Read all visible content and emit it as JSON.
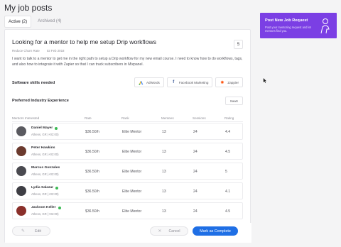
{
  "page": {
    "title": "My job posts"
  },
  "tabs": [
    {
      "label": "Active (2)",
      "active": true
    },
    {
      "label": "Archived (4)",
      "active": false
    }
  ],
  "job": {
    "title": "Looking for a mentor to help me setup Drip workflows",
    "category": "Reduce Churn Rate",
    "date": "02 Feb 2018",
    "count": "5",
    "description": "I want to talk to a mentor to get me in the right path to setup a Drip workflow for my new email course. I need to know how to do workflows, tags, and also how to integrate it with Zapier so that I can track subscribers in Mixpanel."
  },
  "skills": {
    "label": "Software skills needed",
    "items": [
      {
        "name": "AdWords",
        "icon": "adwords-icon",
        "color": "#4285f4"
      },
      {
        "name": "Facebook Marketing",
        "icon": "facebook-icon",
        "color": "#3b5998"
      },
      {
        "name": "Zappier",
        "icon": "zapier-icon",
        "color": "#ff4a00"
      }
    ]
  },
  "industry": {
    "label": "Preferred Industry Experience",
    "value": "SaaS"
  },
  "table": {
    "headers": {
      "mentor": "Mentors Interested",
      "rate": "Rate",
      "rank": "Rank",
      "mentees": "Mentees",
      "sessions": "Sessions",
      "rating": "Rating"
    },
    "rows": [
      {
        "name": "Daniel Mayer",
        "location": "Athens, GR (+02:00)",
        "online": true,
        "rate": "$36.50/h",
        "rank": "Elite Mentor",
        "mentees": "13",
        "sessions": "24",
        "rating": "4.4",
        "avatar_color": "#5a5a60"
      },
      {
        "name": "Peter Hawkins",
        "location": "Athens, GR (+02:00)",
        "online": false,
        "rate": "$36.50/h",
        "rank": "Elite Mentor",
        "mentees": "13",
        "sessions": "24",
        "rating": "4.5",
        "avatar_color": "#6b3a2e"
      },
      {
        "name": "Marcus Gonzales",
        "location": "Athens, GR (+02:00)",
        "online": false,
        "rate": "$36.50/h",
        "rank": "Elite Mentor",
        "mentees": "13",
        "sessions": "24",
        "rating": "5",
        "avatar_color": "#4a4a50"
      },
      {
        "name": "Lydia Salazar",
        "location": "Athens, GR (+02:00)",
        "online": true,
        "rate": "$36.50/h",
        "rank": "Elite Mentor",
        "mentees": "13",
        "sessions": "24",
        "rating": "4.1",
        "avatar_color": "#3e3e44"
      },
      {
        "name": "Jackson Keller",
        "location": "Athens, GR (+02:00)",
        "online": true,
        "rate": "$36.50/h",
        "rank": "Elite Mentor",
        "mentees": "13",
        "sessions": "24",
        "rating": "4.5",
        "avatar_color": "#8a2f2a"
      }
    ]
  },
  "footer": {
    "edit_label": "Edit",
    "cancel_label": "Cancel",
    "complete_label": "Mark as Complete"
  },
  "promo": {
    "title": "Post New Job Request",
    "text": "Post your mentoring request and let mentors find you.",
    "icon": "person-icon",
    "color": "#7b3fe4"
  },
  "colors": {
    "accent": "#1f6fe5",
    "online": "#3cba54"
  }
}
